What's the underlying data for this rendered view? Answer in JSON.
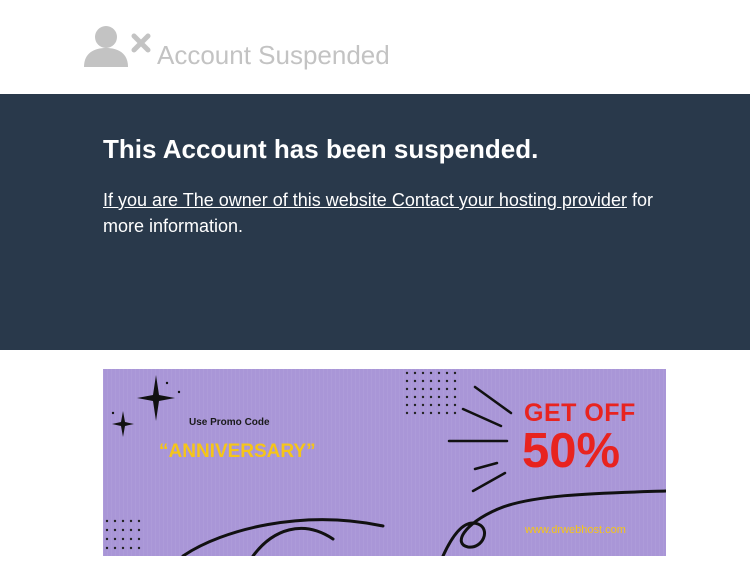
{
  "header": {
    "title": "Account Suspended",
    "icon": "user-x-icon"
  },
  "panel": {
    "headline": "This Account has been suspended.",
    "link_text": "If you are The owner of this website Contact your hosting provider",
    "suffix_text": " for more information."
  },
  "banner": {
    "promo_label": "Use Promo Code",
    "promo_code": "“ANNIVERSARY”",
    "offer_line1": "GET OFF",
    "offer_line2": "50%",
    "site_url": "www.drwebhost.com"
  },
  "colors": {
    "panel_bg": "#29394b",
    "banner_bg": "#a996d7",
    "accent_red": "#e8231f",
    "accent_yellow": "#f5c518",
    "header_text": "#c3c3c3"
  }
}
